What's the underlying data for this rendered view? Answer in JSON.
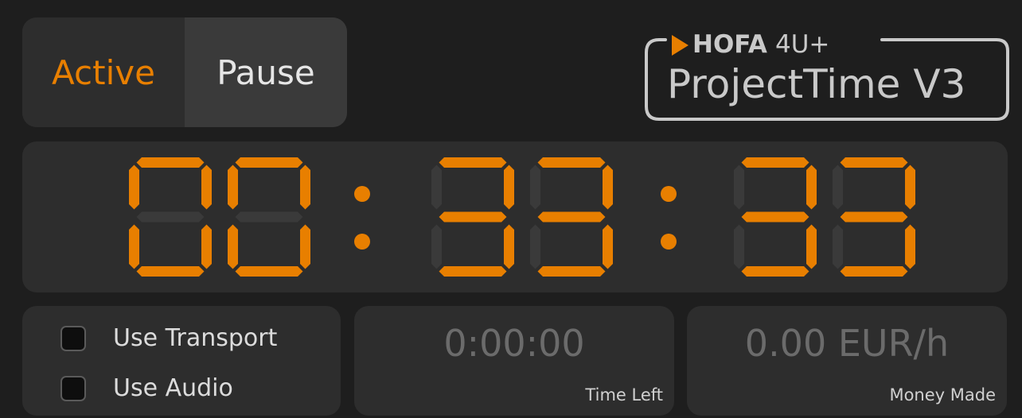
{
  "toggle": {
    "active_label": "Active",
    "pause_label": "Pause",
    "selected": "Active",
    "active_color": "#e87f00",
    "pause_color": "#e6e6e6"
  },
  "logo": {
    "brand": "HOFA",
    "edition": "4U+",
    "product": "ProjectTime V3",
    "accent": "#e87f00",
    "icon": "play-triangle-icon"
  },
  "timer": {
    "display": "00:33:33",
    "hours": "00",
    "minutes": "33",
    "seconds": "33",
    "segment_on_color": "#e87f00",
    "segment_off_color": "#3a3a3a",
    "separator": ":"
  },
  "options": {
    "transport_label": "Use Transport",
    "transport_checked": false,
    "audio_label": "Use Audio",
    "audio_checked": false
  },
  "time_left": {
    "value": "0:00:00",
    "caption": "Time Left"
  },
  "money": {
    "value": "0.00 EUR/h",
    "caption": "Money Made"
  }
}
